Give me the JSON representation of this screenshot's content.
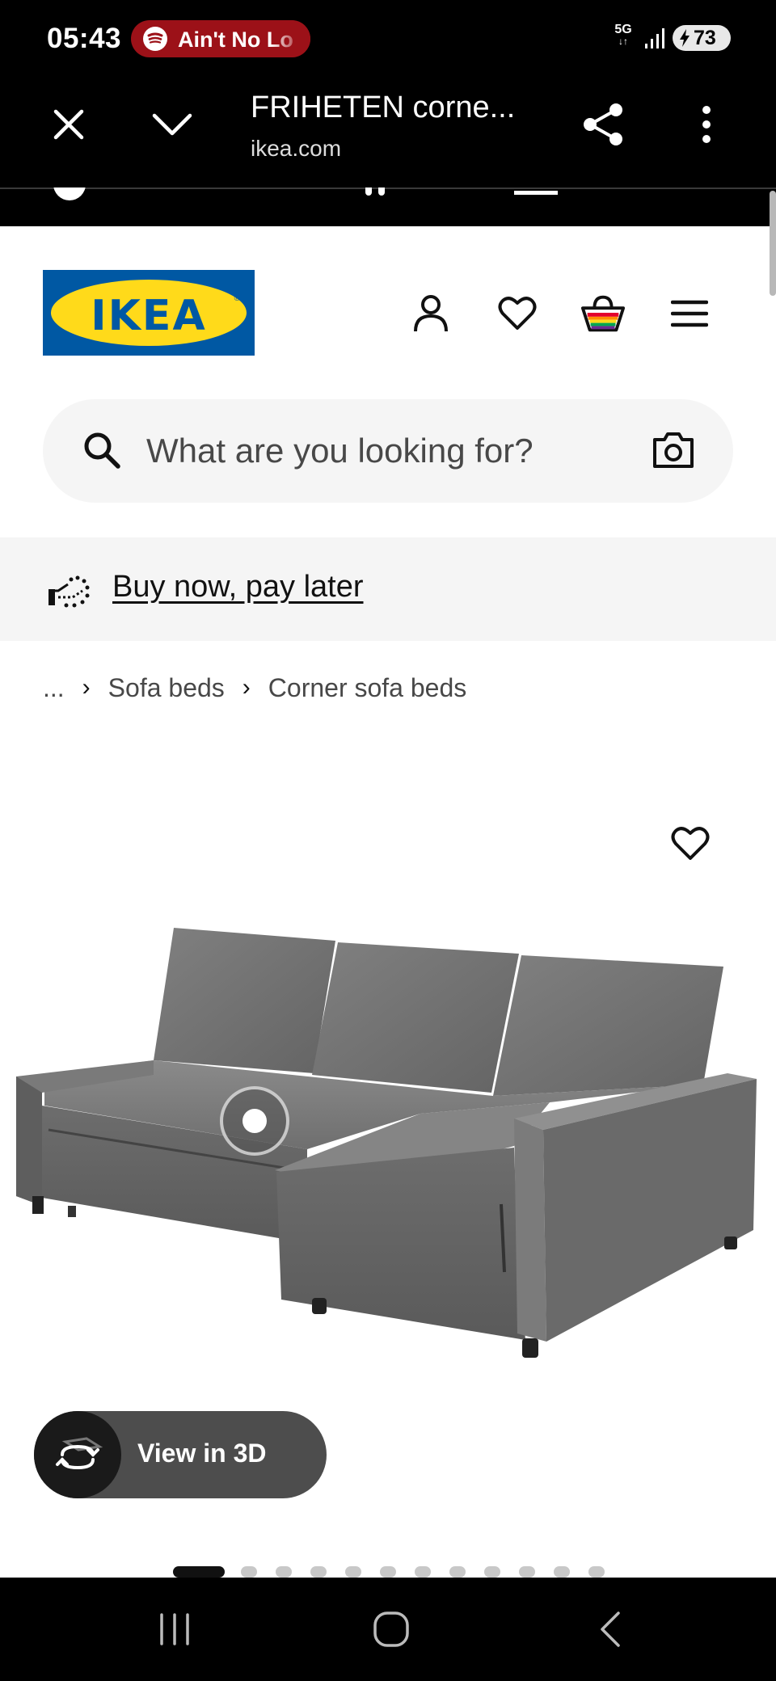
{
  "status_bar": {
    "time": "05:43",
    "now_playing": "Ain't No Lo",
    "network": "5G",
    "battery": "73"
  },
  "browser": {
    "title": "FRIHETEN corne...",
    "url": "ikea.com"
  },
  "header": {
    "logo_text": "IKEA"
  },
  "search": {
    "placeholder": "What are you looking for?"
  },
  "promo": {
    "link": "Buy now, pay later"
  },
  "breadcrumb": {
    "ellipsis": "...",
    "items": [
      "Sofa beds",
      "Corner sofa beds"
    ]
  },
  "product": {
    "view_3d_label": "View in 3D",
    "image_count": 12,
    "active_image": 1
  }
}
